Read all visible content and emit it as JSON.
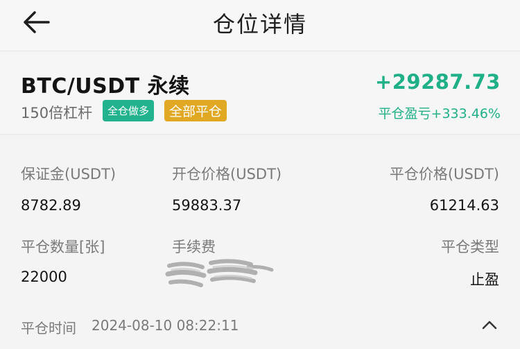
{
  "header": {
    "title": "仓位详情",
    "back_icon": "arrow-left-icon"
  },
  "summary": {
    "pair": "BTC/USDT 永续",
    "leverage": "150倍杠杆",
    "position_badge": "全仓做多",
    "close_all_button": "全部平仓",
    "pnl": "+29287.73",
    "pnl_pct": "平仓盈亏+333.46%",
    "accent_green": "#1fb088",
    "accent_gold": "#e1a823"
  },
  "details": {
    "margin_label": "保证金(USDT)",
    "margin_value": "8782.89",
    "open_price_label": "开仓价格(USDT)",
    "open_price_value": "59883.37",
    "close_price_label": "平仓价格(USDT)",
    "close_price_value": "61214.63",
    "close_qty_label": "平仓数量[张]",
    "close_qty_value": "22000",
    "fee_label": "手续费",
    "close_type_label": "平仓类型",
    "close_type_value": "止盈"
  },
  "footer": {
    "close_time_label": "平仓时间",
    "close_time_value": "2024-08-10 08:22:11",
    "toggle_icon": "chevron-up-icon"
  }
}
